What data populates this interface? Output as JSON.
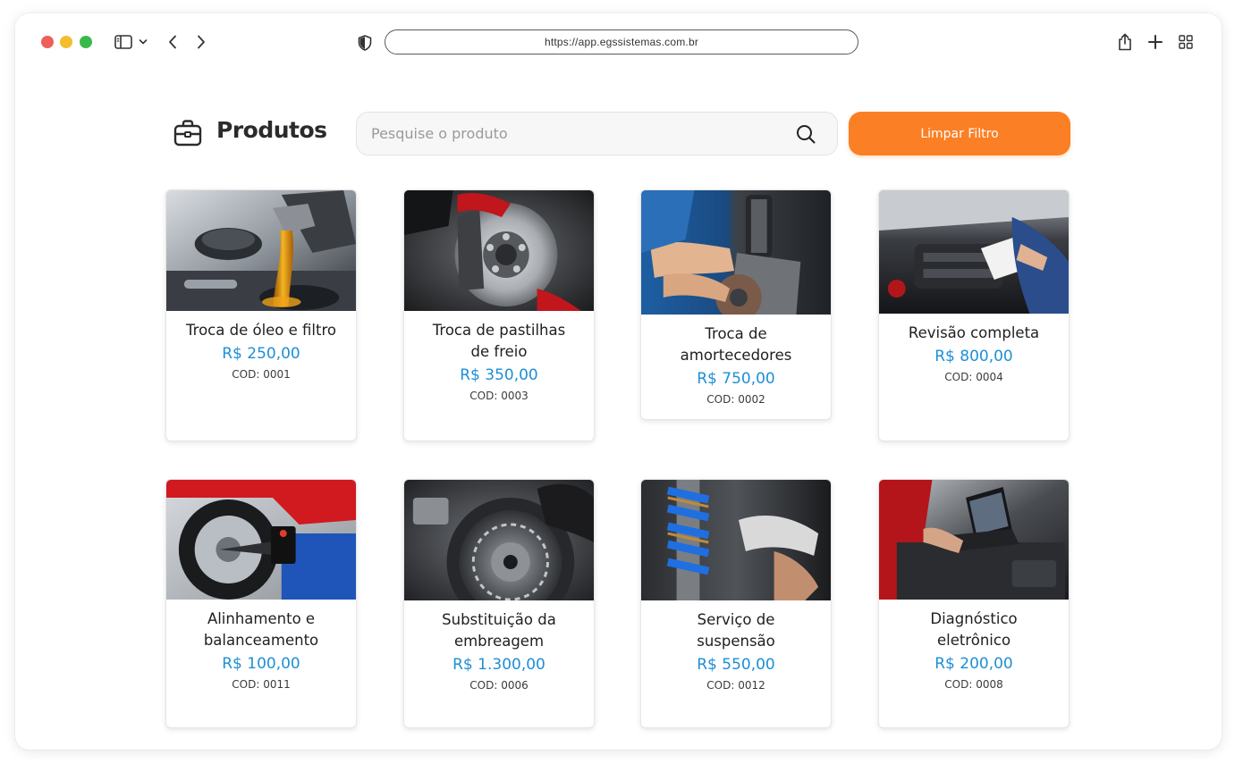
{
  "browser": {
    "url": "https://app.egssistemas.com.br"
  },
  "header": {
    "title": "Produtos",
    "search_placeholder": "Pesquise o produto",
    "search_value": "",
    "clear_button_label": "Limpar Filtro"
  },
  "colors": {
    "accent": "#fb7f25",
    "price": "#1e8fd5"
  },
  "products": [
    {
      "name": "Troca de óleo e filtro",
      "price": "R$ 250,00",
      "code": "COD: 0001",
      "image": "oil-change-photo"
    },
    {
      "name": "Troca de pastilhas de freio",
      "price": "R$ 350,00",
      "code": "COD: 0003",
      "image": "brake-disc-photo"
    },
    {
      "name": "Troca de amortecedores",
      "price": "R$ 750,00",
      "code": "COD: 0002",
      "image": "shock-absorber-photo"
    },
    {
      "name": "Revisão completa",
      "price": "R$ 800,00",
      "code": "COD: 0004",
      "image": "engine-inspection-photo"
    },
    {
      "name": "Alinhamento e balanceamento",
      "price": "R$ 100,00",
      "code": "COD: 0011",
      "image": "wheel-alignment-photo"
    },
    {
      "name": "Substituição da embreagem",
      "price": "R$ 1.300,00",
      "code": "COD: 0006",
      "image": "clutch-plate-photo"
    },
    {
      "name": "Serviço de suspensão",
      "price": "R$ 550,00",
      "code": "COD: 0012",
      "image": "suspension-spring-photo"
    },
    {
      "name": "Diagnóstico eletrônico",
      "price": "R$ 200,00",
      "code": "COD: 0008",
      "image": "laptop-diagnostic-photo"
    }
  ]
}
